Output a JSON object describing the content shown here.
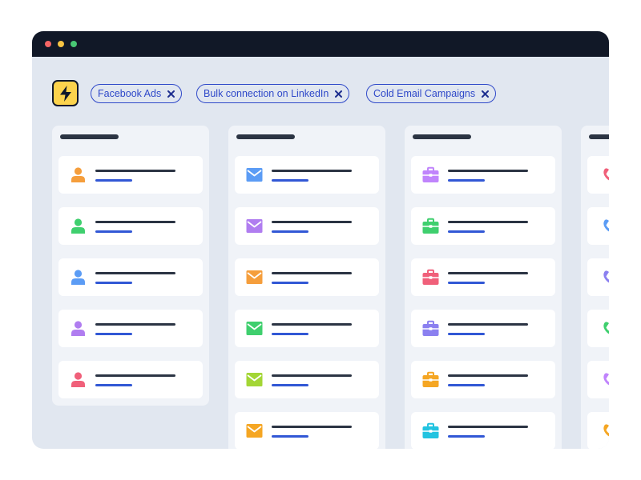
{
  "window": {
    "controls": [
      {
        "name": "close",
        "color": "#f56565"
      },
      {
        "name": "minimize",
        "color": "#f6c443"
      },
      {
        "name": "zoom",
        "color": "#48c774"
      }
    ]
  },
  "filters": [
    {
      "label": "Facebook Ads"
    },
    {
      "label": "Bulk connection on LinkedIn"
    },
    {
      "label": "Cold Email Campaigns"
    }
  ],
  "columns": [
    {
      "type": "person",
      "icon_name": "person-icon",
      "cards": [
        {
          "color": "#f59e3c"
        },
        {
          "color": "#3fcf6e"
        },
        {
          "color": "#5b9cf5"
        },
        {
          "color": "#b07df0"
        },
        {
          "color": "#f0607a"
        }
      ]
    },
    {
      "type": "envelope",
      "icon_name": "envelope-icon",
      "cards": [
        {
          "color": "#5b9cf5"
        },
        {
          "color": "#b07df0"
        },
        {
          "color": "#f59e3c"
        },
        {
          "color": "#3fcf6e"
        },
        {
          "color": "#a3d635"
        },
        {
          "color": "#f5a623"
        }
      ]
    },
    {
      "type": "briefcase",
      "icon_name": "briefcase-icon",
      "cards": [
        {
          "color": "#c084fc"
        },
        {
          "color": "#3fcf6e"
        },
        {
          "color": "#f0607a"
        },
        {
          "color": "#8b80f0"
        },
        {
          "color": "#f5a623"
        },
        {
          "color": "#22c3e0"
        }
      ]
    },
    {
      "type": "phone",
      "icon_name": "phone-icon",
      "cards": [
        {
          "color": "#f0607a"
        },
        {
          "color": "#5b9cf5"
        },
        {
          "color": "#8b80f0"
        },
        {
          "color": "#3fcf6e"
        },
        {
          "color": "#c084fc"
        },
        {
          "color": "#f5a623"
        }
      ]
    }
  ]
}
